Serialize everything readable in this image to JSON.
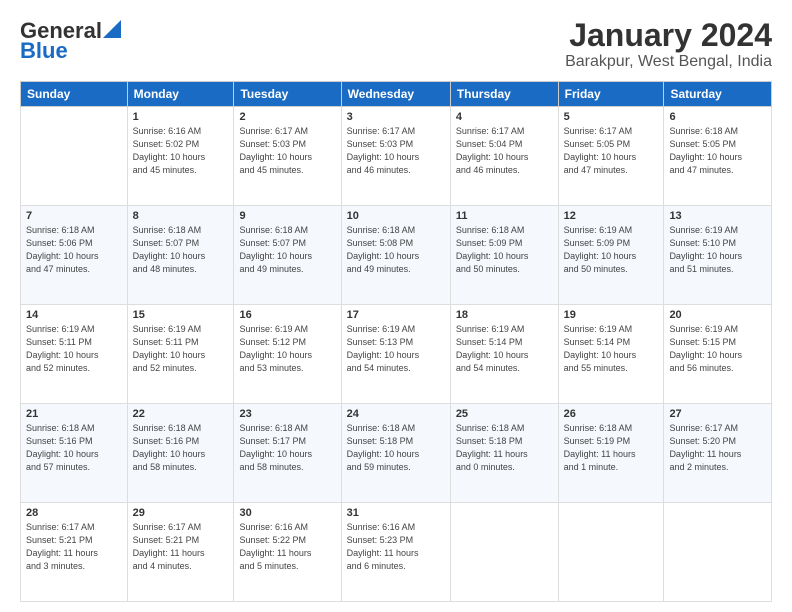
{
  "header": {
    "logo_general": "General",
    "logo_blue": "Blue",
    "title": "January 2024",
    "subtitle": "Barakpur, West Bengal, India"
  },
  "columns": [
    "Sunday",
    "Monday",
    "Tuesday",
    "Wednesday",
    "Thursday",
    "Friday",
    "Saturday"
  ],
  "weeks": [
    [
      {
        "day": "",
        "info": ""
      },
      {
        "day": "1",
        "info": "Sunrise: 6:16 AM\nSunset: 5:02 PM\nDaylight: 10 hours\nand 45 minutes."
      },
      {
        "day": "2",
        "info": "Sunrise: 6:17 AM\nSunset: 5:03 PM\nDaylight: 10 hours\nand 45 minutes."
      },
      {
        "day": "3",
        "info": "Sunrise: 6:17 AM\nSunset: 5:03 PM\nDaylight: 10 hours\nand 46 minutes."
      },
      {
        "day": "4",
        "info": "Sunrise: 6:17 AM\nSunset: 5:04 PM\nDaylight: 10 hours\nand 46 minutes."
      },
      {
        "day": "5",
        "info": "Sunrise: 6:17 AM\nSunset: 5:05 PM\nDaylight: 10 hours\nand 47 minutes."
      },
      {
        "day": "6",
        "info": "Sunrise: 6:18 AM\nSunset: 5:05 PM\nDaylight: 10 hours\nand 47 minutes."
      }
    ],
    [
      {
        "day": "7",
        "info": "Sunrise: 6:18 AM\nSunset: 5:06 PM\nDaylight: 10 hours\nand 47 minutes."
      },
      {
        "day": "8",
        "info": "Sunrise: 6:18 AM\nSunset: 5:07 PM\nDaylight: 10 hours\nand 48 minutes."
      },
      {
        "day": "9",
        "info": "Sunrise: 6:18 AM\nSunset: 5:07 PM\nDaylight: 10 hours\nand 49 minutes."
      },
      {
        "day": "10",
        "info": "Sunrise: 6:18 AM\nSunset: 5:08 PM\nDaylight: 10 hours\nand 49 minutes."
      },
      {
        "day": "11",
        "info": "Sunrise: 6:18 AM\nSunset: 5:09 PM\nDaylight: 10 hours\nand 50 minutes."
      },
      {
        "day": "12",
        "info": "Sunrise: 6:19 AM\nSunset: 5:09 PM\nDaylight: 10 hours\nand 50 minutes."
      },
      {
        "day": "13",
        "info": "Sunrise: 6:19 AM\nSunset: 5:10 PM\nDaylight: 10 hours\nand 51 minutes."
      }
    ],
    [
      {
        "day": "14",
        "info": "Sunrise: 6:19 AM\nSunset: 5:11 PM\nDaylight: 10 hours\nand 52 minutes."
      },
      {
        "day": "15",
        "info": "Sunrise: 6:19 AM\nSunset: 5:11 PM\nDaylight: 10 hours\nand 52 minutes."
      },
      {
        "day": "16",
        "info": "Sunrise: 6:19 AM\nSunset: 5:12 PM\nDaylight: 10 hours\nand 53 minutes."
      },
      {
        "day": "17",
        "info": "Sunrise: 6:19 AM\nSunset: 5:13 PM\nDaylight: 10 hours\nand 54 minutes."
      },
      {
        "day": "18",
        "info": "Sunrise: 6:19 AM\nSunset: 5:14 PM\nDaylight: 10 hours\nand 54 minutes."
      },
      {
        "day": "19",
        "info": "Sunrise: 6:19 AM\nSunset: 5:14 PM\nDaylight: 10 hours\nand 55 minutes."
      },
      {
        "day": "20",
        "info": "Sunrise: 6:19 AM\nSunset: 5:15 PM\nDaylight: 10 hours\nand 56 minutes."
      }
    ],
    [
      {
        "day": "21",
        "info": "Sunrise: 6:18 AM\nSunset: 5:16 PM\nDaylight: 10 hours\nand 57 minutes."
      },
      {
        "day": "22",
        "info": "Sunrise: 6:18 AM\nSunset: 5:16 PM\nDaylight: 10 hours\nand 58 minutes."
      },
      {
        "day": "23",
        "info": "Sunrise: 6:18 AM\nSunset: 5:17 PM\nDaylight: 10 hours\nand 58 minutes."
      },
      {
        "day": "24",
        "info": "Sunrise: 6:18 AM\nSunset: 5:18 PM\nDaylight: 10 hours\nand 59 minutes."
      },
      {
        "day": "25",
        "info": "Sunrise: 6:18 AM\nSunset: 5:18 PM\nDaylight: 11 hours\nand 0 minutes."
      },
      {
        "day": "26",
        "info": "Sunrise: 6:18 AM\nSunset: 5:19 PM\nDaylight: 11 hours\nand 1 minute."
      },
      {
        "day": "27",
        "info": "Sunrise: 6:17 AM\nSunset: 5:20 PM\nDaylight: 11 hours\nand 2 minutes."
      }
    ],
    [
      {
        "day": "28",
        "info": "Sunrise: 6:17 AM\nSunset: 5:21 PM\nDaylight: 11 hours\nand 3 minutes."
      },
      {
        "day": "29",
        "info": "Sunrise: 6:17 AM\nSunset: 5:21 PM\nDaylight: 11 hours\nand 4 minutes."
      },
      {
        "day": "30",
        "info": "Sunrise: 6:16 AM\nSunset: 5:22 PM\nDaylight: 11 hours\nand 5 minutes."
      },
      {
        "day": "31",
        "info": "Sunrise: 6:16 AM\nSunset: 5:23 PM\nDaylight: 11 hours\nand 6 minutes."
      },
      {
        "day": "",
        "info": ""
      },
      {
        "day": "",
        "info": ""
      },
      {
        "day": "",
        "info": ""
      }
    ]
  ]
}
